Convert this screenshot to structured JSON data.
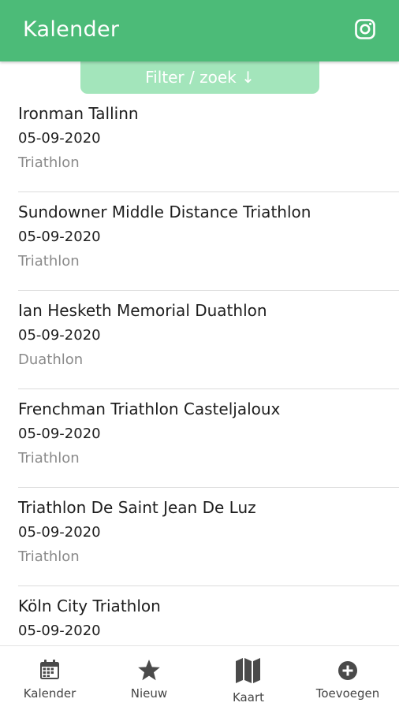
{
  "header": {
    "title": "Kalender",
    "instagram_icon": "instagram-icon"
  },
  "filter": {
    "label": "Filter / zoek ↓"
  },
  "events": [
    {
      "name": "Ironman Tallinn",
      "date": "05-09-2020",
      "type": "Triathlon"
    },
    {
      "name": "Sundowner Middle Distance Triathlon",
      "date": "05-09-2020",
      "type": "Triathlon"
    },
    {
      "name": "Ian Hesketh Memorial Duathlon",
      "date": "05-09-2020",
      "type": "Duathlon"
    },
    {
      "name": "Frenchman Triathlon Casteljaloux",
      "date": "05-09-2020",
      "type": "Triathlon"
    },
    {
      "name": "Triathlon De Saint Jean De Luz",
      "date": "05-09-2020",
      "type": "Triathlon"
    },
    {
      "name": "Köln City Triathlon",
      "date": "05-09-2020",
      "type": ""
    }
  ],
  "nav": [
    {
      "label": "Kalender",
      "icon": "calendar-icon"
    },
    {
      "label": "Nieuw",
      "icon": "star-icon"
    },
    {
      "label": "Kaart",
      "icon": "map-icon"
    },
    {
      "label": "Toevoegen",
      "icon": "plus-circle-icon"
    }
  ],
  "colors": {
    "primary": "#4cbb78",
    "filter_bg": "#a3e5bb",
    "muted_text": "#8a8a8a"
  }
}
